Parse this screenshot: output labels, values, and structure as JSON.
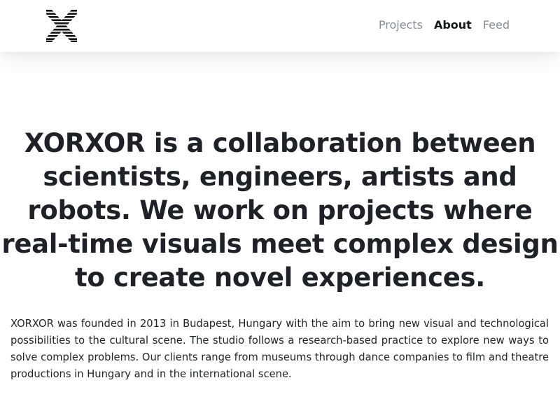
{
  "header": {
    "logo_icon": "xorxor-striped-x-logo-icon",
    "nav": {
      "projects": "Projects",
      "about": "About",
      "feed": "Feed"
    },
    "active_item": "About"
  },
  "main": {
    "headline": "XORXOR is a collaboration between scientists, engineers, artists and robots. We work on projects where real-time visuals meet complex design to create novel experiences.",
    "description": "XORXOR was founded in 2013 in Budapest, Hungary with the aim to bring new visual and technological possibilities to the cultural scene. The studio follows a research-based practice to explore new ways to solve complex problems. Our clients range from museums through dance companies to film and theatre productions in Hungary and in the international scene."
  },
  "colors": {
    "text_dark": "#1f2126",
    "nav_inactive": "#8a8c93",
    "nav_active": "#15171a",
    "background": "#ffffff"
  }
}
